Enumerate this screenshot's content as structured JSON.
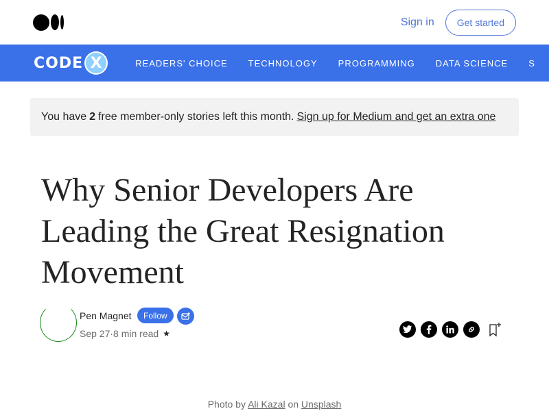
{
  "header": {
    "logo_icon": "medium-logo-icon",
    "signin_label": "Sign in",
    "getstarted_label": "Get started",
    "accent_color": "#4f76d8"
  },
  "publication": {
    "logo_text": "CODE",
    "logo_mark": "X",
    "bg_color": "#3a70e8",
    "nav_items": [
      "READERS' CHOICE",
      "TECHNOLOGY",
      "PROGRAMMING",
      "DATA SCIENCE",
      "S"
    ]
  },
  "banner": {
    "prefix": "You have",
    "count": "2",
    "suffix": "free member-only stories left this month.",
    "link": "Sign up for Medium and get an extra one"
  },
  "article": {
    "title": "Why Senior Developers Are Leading the Great Resignation Movement"
  },
  "author": {
    "name": "Pen Magnet",
    "follow_label": "Follow",
    "subscribe_icon": "mail-plus-icon",
    "date": "Sep 27",
    "separator": "·",
    "read_time": "8 min read",
    "member_icon": "star-icon"
  },
  "share": {
    "icons": [
      "twitter-icon",
      "facebook-icon",
      "linkedin-icon",
      "link-icon"
    ],
    "bookmark_icon": "bookmark-add-icon"
  },
  "caption": {
    "prefix": "Photo by",
    "photographer": "Ali Kazal",
    "on": "on",
    "source": "Unsplash"
  }
}
